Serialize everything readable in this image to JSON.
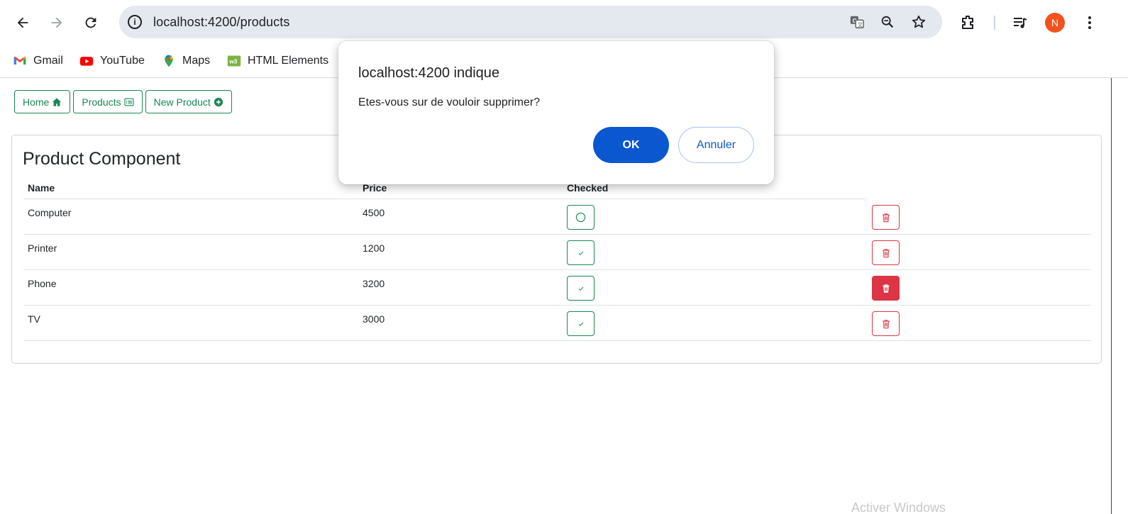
{
  "browser": {
    "url": "localhost:4200/products",
    "avatar_letter": "N",
    "avatar_color": "#f4511e",
    "icons": [
      "back-arrow-icon",
      "forward-arrow-icon",
      "reload-icon",
      "site-info-icon",
      "translate-icon",
      "zoom-icon",
      "star-icon",
      "extensions-icon",
      "media-icon",
      "more-icon"
    ]
  },
  "bookmarks": [
    {
      "label": "Gmail",
      "icon": "gmail-icon"
    },
    {
      "label": "YouTube",
      "icon": "youtube-icon"
    },
    {
      "label": "Maps",
      "icon": "maps-icon"
    },
    {
      "label": "HTML Elements",
      "icon": "html-elements-icon"
    }
  ],
  "nav": {
    "home": "Home",
    "products": "Products",
    "new_product": "New Product"
  },
  "card": {
    "title": "Product Component",
    "columns": [
      "Name",
      "Price",
      "Checked"
    ],
    "rows": [
      {
        "name": "Computer",
        "price": "4500",
        "checked": false
      },
      {
        "name": "Printer",
        "price": "1200",
        "checked": true
      },
      {
        "name": "Phone",
        "price": "3200",
        "checked": true
      },
      {
        "name": "TV",
        "price": "3000",
        "checked": true
      }
    ]
  },
  "dialog": {
    "title": "localhost:4200 indique",
    "message": "Etes-vous sur de vouloir supprimer?",
    "ok_label": "OK",
    "cancel_label": "Annuler"
  },
  "colors": {
    "success": "#198754",
    "danger": "#dc3545",
    "dialog_primary": "#0b57d0"
  },
  "watermark": "Activer Windows"
}
